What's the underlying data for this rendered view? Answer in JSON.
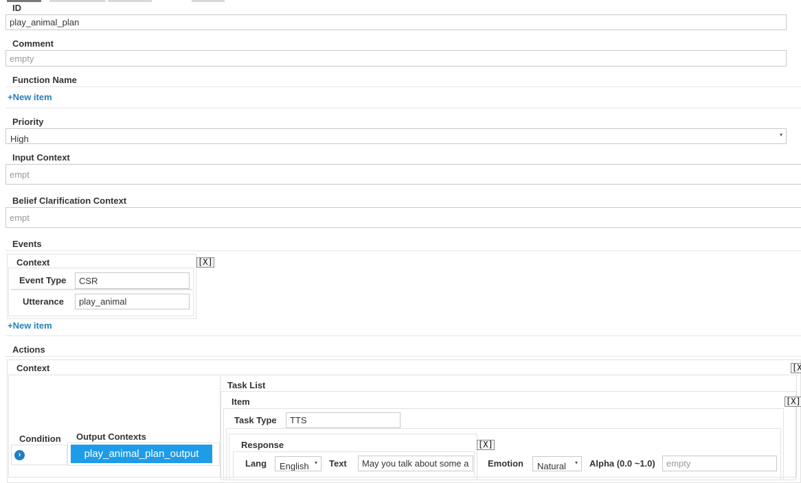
{
  "fields": {
    "id": {
      "label": "ID",
      "value": "play_animal_plan"
    },
    "comment": {
      "label": "Comment",
      "placeholder": "empty"
    },
    "function_name": {
      "label": "Function Name",
      "new_item": "+New item"
    },
    "priority": {
      "label": "Priority",
      "value": "High"
    },
    "input_context": {
      "label": "Input Context",
      "placeholder": "empt"
    },
    "belief_context": {
      "label": "Belief Clarification Context",
      "placeholder": "empt"
    }
  },
  "events": {
    "label": "Events",
    "context_label": "Context",
    "remove": "[X]",
    "event_type_label": "Event Type",
    "event_type_value": "CSR",
    "utterance_label": "Utterance",
    "utterance_value": "play_animal",
    "new_item": "+New item"
  },
  "actions": {
    "label": "Actions",
    "context_label": "Context",
    "remove": "[X]",
    "condition_label": "Condition",
    "output_contexts_label": "Output Contexts",
    "output_context_tag": "play_animal_plan_output",
    "task_list_label": "Task List",
    "item_label": "Item",
    "item_remove": "[X]",
    "task_type_label": "Task Type",
    "task_type_value": "TTS",
    "response_label": "Response",
    "response_remove": "[X]",
    "lang_label": "Lang",
    "lang_value": "English",
    "text_label": "Text",
    "text_value": "May you talk about some a",
    "emotion_label": "Emotion",
    "emotion_value": "Natural",
    "alpha_label": "Alpha (0.0 ~1.0)",
    "alpha_placeholder": "empty"
  }
}
